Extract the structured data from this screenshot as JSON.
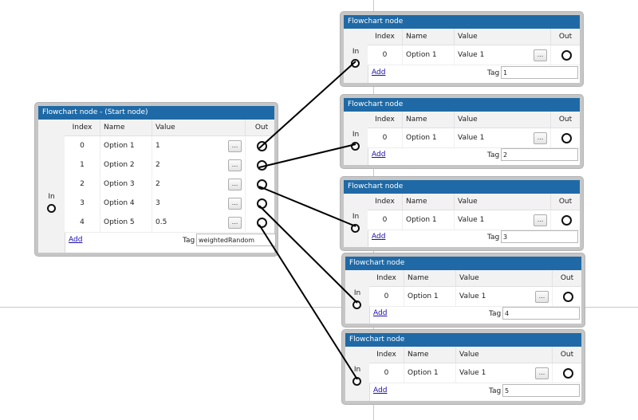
{
  "start_node": {
    "title": "Flowchart node - (Start node)",
    "in_label": "In",
    "columns": {
      "index": "Index",
      "name": "Name",
      "value": "Value",
      "out": "Out"
    },
    "rows": [
      {
        "index": "0",
        "name": "Option 1",
        "value": "1",
        "button": "..."
      },
      {
        "index": "1",
        "name": "Option 2",
        "value": "2",
        "button": "..."
      },
      {
        "index": "2",
        "name": "Option 3",
        "value": "2",
        "button": "..."
      },
      {
        "index": "3",
        "name": "Option 4",
        "value": "3",
        "button": "..."
      },
      {
        "index": "4",
        "name": "Option 5",
        "value": "0.5",
        "button": "..."
      }
    ],
    "add_label": "Add",
    "tag_label": "Tag",
    "tag_value": "weightedRandom"
  },
  "target_nodes": [
    {
      "title": "Flowchart node",
      "in_label": "In",
      "columns": {
        "index": "Index",
        "name": "Name",
        "value": "Value",
        "out": "Out"
      },
      "row": {
        "index": "0",
        "name": "Option 1",
        "value": "Value 1",
        "button": "..."
      },
      "add_label": "Add",
      "tag_label": "Tag",
      "tag_value": "1"
    },
    {
      "title": "Flowchart node",
      "in_label": "In",
      "columns": {
        "index": "Index",
        "name": "Name",
        "value": "Value",
        "out": "Out"
      },
      "row": {
        "index": "0",
        "name": "Option 1",
        "value": "Value 1",
        "button": "..."
      },
      "add_label": "Add",
      "tag_label": "Tag",
      "tag_value": "2"
    },
    {
      "title": "Flowchart node",
      "in_label": "In",
      "columns": {
        "index": "Index",
        "name": "Name",
        "value": "Value",
        "out": "Out"
      },
      "row": {
        "index": "0",
        "name": "Option 1",
        "value": "Value 1",
        "button": "..."
      },
      "add_label": "Add",
      "tag_label": "Tag",
      "tag_value": "3"
    },
    {
      "title": "Flowchart node",
      "in_label": "In",
      "columns": {
        "index": "Index",
        "name": "Name",
        "value": "Value",
        "out": "Out"
      },
      "row": {
        "index": "0",
        "name": "Option 1",
        "value": "Value 1",
        "button": "..."
      },
      "add_label": "Add",
      "tag_label": "Tag",
      "tag_value": "4"
    },
    {
      "title": "Flowchart node",
      "in_label": "In",
      "columns": {
        "index": "Index",
        "name": "Name",
        "value": "Value",
        "out": "Out"
      },
      "row": {
        "index": "0",
        "name": "Option 1",
        "value": "Value 1",
        "button": "..."
      },
      "add_label": "Add",
      "tag_label": "Tag",
      "tag_value": "5"
    }
  ],
  "colors": {
    "header": "#1f6aa6",
    "connector": "#000000",
    "node_border": "#c6c6c6"
  },
  "icons": {
    "in_port": "circle-port-icon",
    "out_port": "circle-port-icon"
  }
}
